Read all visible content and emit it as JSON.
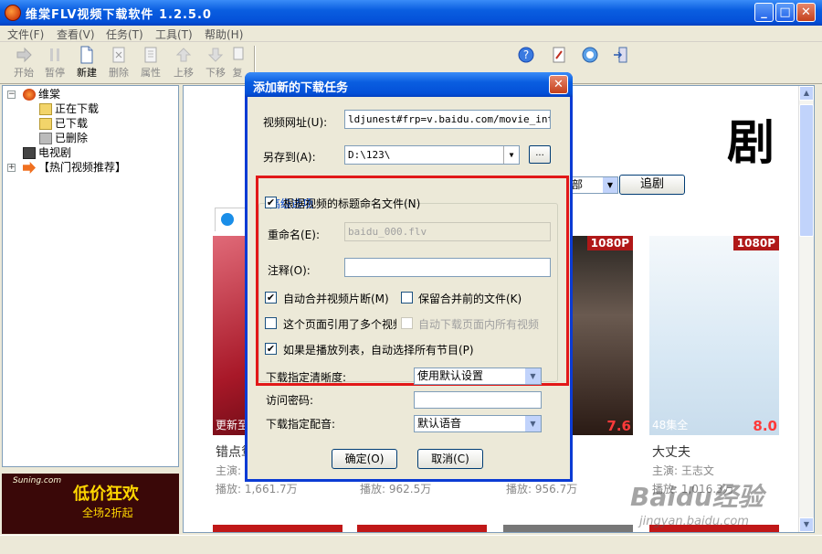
{
  "window": {
    "title": "维棠FLV视频下载软件 1.2.5.0",
    "min": "_",
    "max": "□",
    "close": "✕"
  },
  "menu": [
    "文件(F)",
    "查看(V)",
    "任务(T)",
    "工具(T)",
    "帮助(H)"
  ],
  "toolbar": {
    "start": "开始",
    "pause": "暂停",
    "new": "新建",
    "delete": "删除",
    "props": "属性",
    "up": "上移",
    "down": "下移",
    "copy": "复"
  },
  "tree": {
    "root": "维棠",
    "downloading": "正在下载",
    "downloaded": "已下载",
    "deleted": "已删除",
    "tv": "电视剧",
    "hot": "【热门视频推荐】"
  },
  "promo": {
    "brand": "Suning.com",
    "line1": "低价狂欢",
    "line2": "全场2折起"
  },
  "content": {
    "heading": "剧",
    "select_value": "部",
    "chase_button": "追剧",
    "cards": [
      {
        "title": "错点鸳",
        "star": "主演: 刘...",
        "plays": "播放: 1,661.7万",
        "eps": "更新至",
        "res": "",
        "rating": "",
        "poster": "#c23a4a"
      },
      {
        "title": "",
        "star": "",
        "plays": "播放: 962.5万",
        "eps": "",
        "res": "",
        "rating": "",
        "poster": "#8a1010"
      },
      {
        "title": "",
        "star": "",
        "plays": "播放: 956.7万",
        "eps": "",
        "res": "1080P",
        "rating": "7.6",
        "poster": "#3a2a22"
      },
      {
        "title": "大丈夫",
        "star": "主演: 王志文",
        "plays": "播放: 1,016.3万",
        "eps": "48集全",
        "res": "1080P",
        "rating": "8.0",
        "poster": "#dbe9f3"
      }
    ]
  },
  "dialog": {
    "title": "添加新的下载任务",
    "url_label": "视频网址(U):",
    "url_value": "ldjunest#frp=v.baidu.com/movie_intro/",
    "saveto_label": "另存到(A):",
    "saveto_value": "D:\\123\\",
    "browse": "...",
    "advanced": "高级选项",
    "opt_title_name": "根据视频的标题命名文件(N)",
    "rename_label": "重命名(E):",
    "rename_value": "baidu_000.flv",
    "note_label": "注释(O):",
    "note_value": "",
    "opt_merge": "自动合并视频片断(M)",
    "opt_keep": "保留合并前的文件(K)",
    "opt_multi": "这个页面引用了多个视频",
    "opt_all": "自动下载页面内所有视频",
    "opt_playlist": "如果是播放列表，自动选择所有节目(P)",
    "quality_label": "下载指定清晰度:",
    "quality_value": "使用默认设置",
    "password_label": "访问密码:",
    "password_value": "",
    "audio_label": "下载指定配音:",
    "audio_value": "默认语音",
    "ok": "确定(O)",
    "cancel": "取消(C)",
    "checked": {
      "title_name": true,
      "merge": true,
      "keep": false,
      "multi": false,
      "all": false,
      "playlist": true
    }
  },
  "watermark": {
    "line1": "Baidu经验",
    "line2": "jingyan.baidu.com"
  }
}
